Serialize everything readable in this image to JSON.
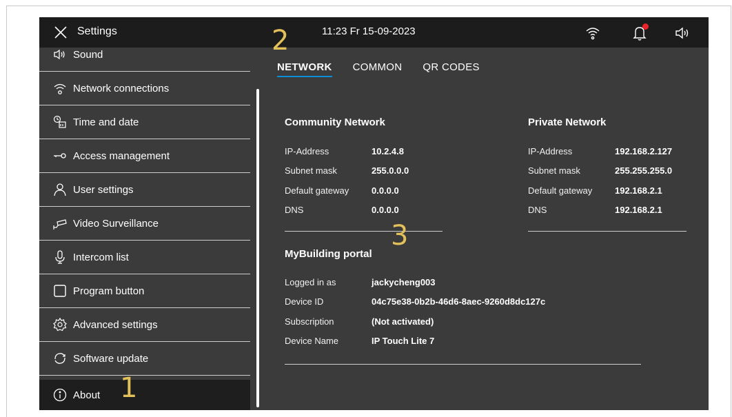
{
  "topbar": {
    "title": "Settings",
    "clock": "11:23  Fr 15-09-2023"
  },
  "sidebar": {
    "items": [
      {
        "label": "Sound",
        "icon": "speaker-icon"
      },
      {
        "label": "Network connections",
        "icon": "wifi-icon"
      },
      {
        "label": "Time and date",
        "icon": "clock-calendar-icon"
      },
      {
        "label": "Access  management",
        "icon": "key-icon"
      },
      {
        "label": "User settings",
        "icon": "user-icon"
      },
      {
        "label": "Video Surveillance",
        "icon": "camera-icon"
      },
      {
        "label": "Intercom list",
        "icon": "microphone-icon"
      },
      {
        "label": "Program button",
        "icon": "square-icon"
      },
      {
        "label": "Advanced settings",
        "icon": "gear-icon"
      },
      {
        "label": "Software update",
        "icon": "refresh-icon"
      },
      {
        "label": "About",
        "icon": "info-icon"
      }
    ],
    "active": "About"
  },
  "tabs": [
    "NETWORK",
    "COMMON",
    "QR CODES"
  ],
  "active_tab": "NETWORK",
  "community_network": {
    "title": "Community Network",
    "rows": [
      {
        "label": "IP-Address",
        "value": "10.2.4.8"
      },
      {
        "label": "Subnet mask",
        "value": "255.0.0.0"
      },
      {
        "label": "Default gateway",
        "value": "0.0.0.0"
      },
      {
        "label": "DNS",
        "value": "0.0.0.0"
      }
    ]
  },
  "private_network": {
    "title": "Private Network",
    "rows": [
      {
        "label": "IP-Address",
        "value": "192.168.2.127"
      },
      {
        "label": "Subnet mask",
        "value": "255.255.255.0"
      },
      {
        "label": "Default gateway",
        "value": "192.168.2.1"
      },
      {
        "label": "DNS",
        "value": "192.168.2.1"
      }
    ]
  },
  "portal": {
    "title": "MyBuilding portal",
    "rows": [
      {
        "label": "Logged in as",
        "value": "jackycheng003"
      },
      {
        "label": "Device ID",
        "value": "04c75e38-0b2b-46d6-8aec-9260d8dc127c"
      },
      {
        "label": "Subscription",
        "value": "(Not activated)"
      },
      {
        "label": "Device Name",
        "value": "IP Touch Lite 7"
      }
    ]
  },
  "markers": [
    "1",
    "2",
    "3"
  ],
  "colors": {
    "accent": "#0a8fd6",
    "background": "#3b3b3b",
    "topbar": "#1c1c1c",
    "notification": "#e8232a",
    "marker": "#e3c15a"
  }
}
